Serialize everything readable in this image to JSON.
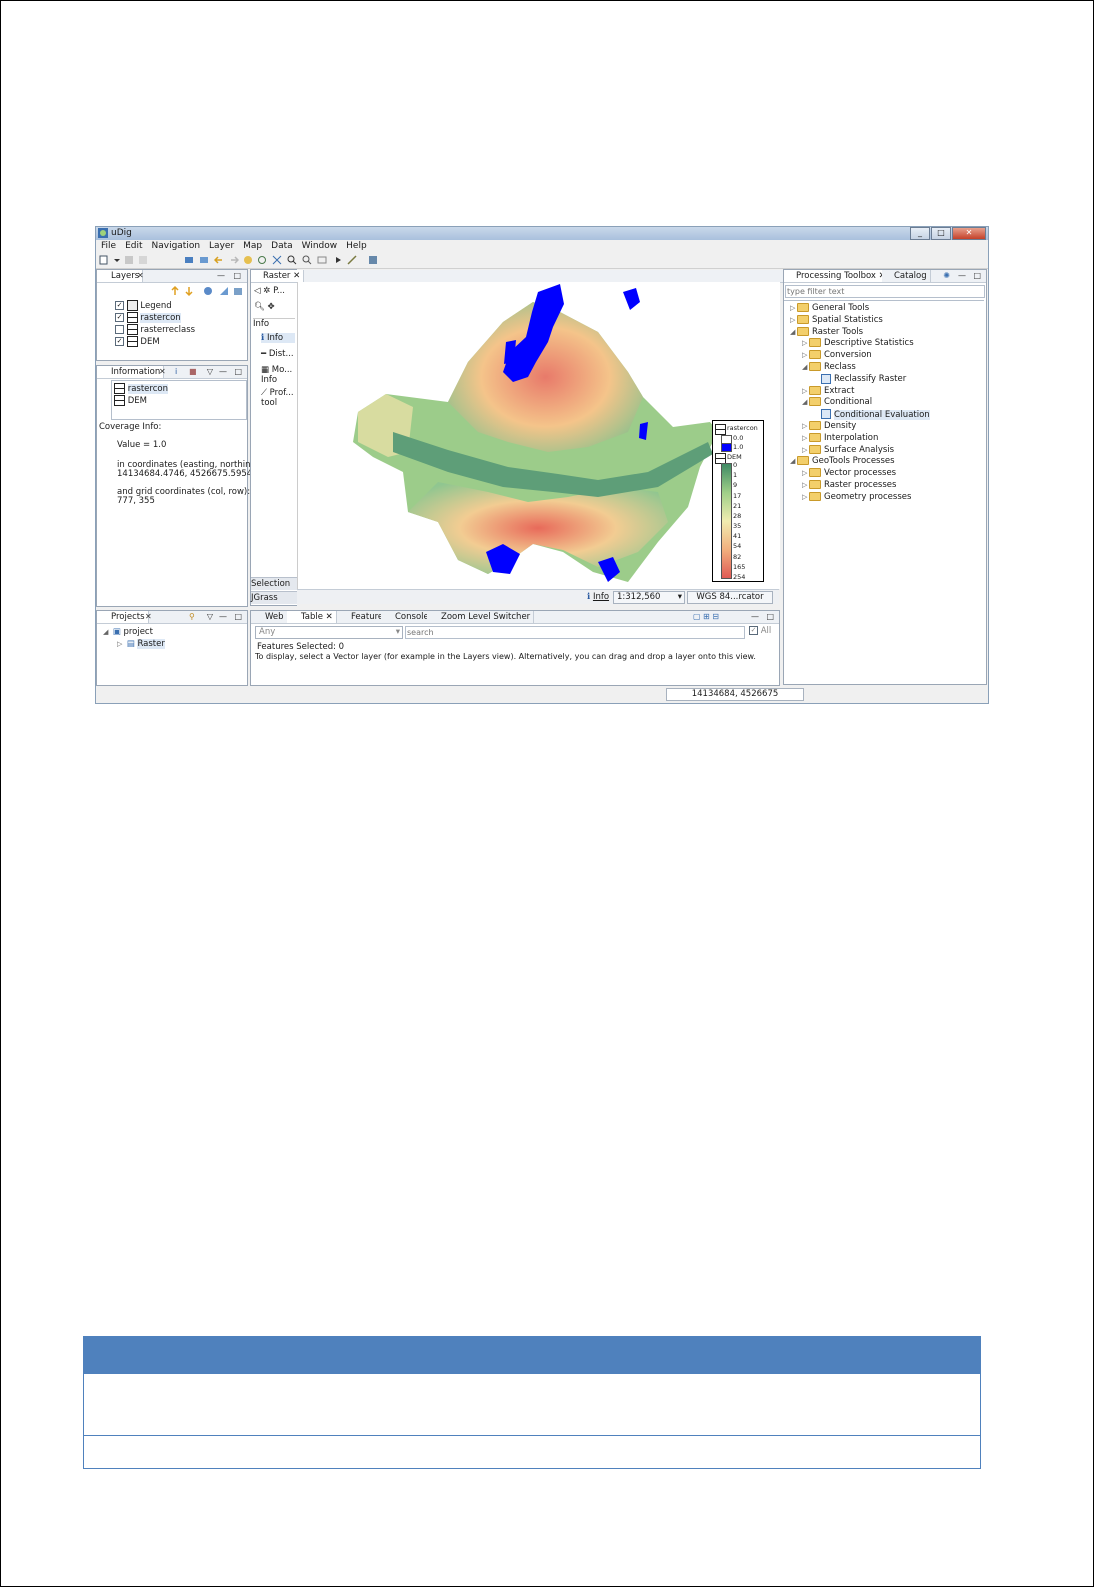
{
  "window": {
    "title": "uDig",
    "controls": [
      "_",
      "□",
      "✕"
    ]
  },
  "menu": [
    "File",
    "Edit",
    "Navigation",
    "Layer",
    "Map",
    "Data",
    "Window",
    "Help"
  ],
  "layers_panel": {
    "tab": "Layers",
    "items": [
      {
        "label": "Legend",
        "checked": true
      },
      {
        "label": "rastercon",
        "checked": true
      },
      {
        "label": "rasterreclass",
        "checked": false
      },
      {
        "label": "DEM",
        "checked": true
      }
    ]
  },
  "information_panel": {
    "tab": "Information",
    "layers": [
      "rastercon",
      "DEM"
    ],
    "coverage_label": "Coverage Info:",
    "value_line": "Value = 1.0",
    "coords_label": "in coordinates (easting, northing):",
    "coords_value": "14134684.4746, 4526675.5954",
    "grid_label": "and grid coordinates (col, row):",
    "grid_value": "777, 355"
  },
  "raster_side": {
    "tab": "Raster",
    "palette_label": "P...",
    "info_header": "Info",
    "tools": [
      "Info",
      "Dist...",
      "Mo... Info",
      "Prof... tool"
    ],
    "bottom_tabs": [
      "Selection",
      "JGrass"
    ]
  },
  "map_status": {
    "info_link": "Info",
    "scale": "1:312,560",
    "crs": "WGS 84...rcator"
  },
  "map_legend": {
    "layer1": "rastercon",
    "layer1_values": [
      "0.0",
      "1.0"
    ],
    "layer2": "DEM",
    "dem_values": [
      "0",
      "1",
      "9",
      "17",
      "21",
      "28",
      "35",
      "41",
      "54",
      "82",
      "165",
      "254"
    ]
  },
  "toolbox": {
    "tabs": [
      "Processing Toolbox",
      "Catalog"
    ],
    "filter_placeholder": "type filter text",
    "tree": [
      {
        "label": "General Tools",
        "depth": 0,
        "kind": "folder",
        "open": false
      },
      {
        "label": "Spatial Statistics",
        "depth": 0,
        "kind": "folder",
        "open": false
      },
      {
        "label": "Raster Tools",
        "depth": 0,
        "kind": "folder",
        "open": true
      },
      {
        "label": "Descriptive Statistics",
        "depth": 1,
        "kind": "folder",
        "open": false
      },
      {
        "label": "Conversion",
        "depth": 1,
        "kind": "folder",
        "open": false
      },
      {
        "label": "Reclass",
        "depth": 1,
        "kind": "folder",
        "open": true
      },
      {
        "label": "Reclassify Raster",
        "depth": 2,
        "kind": "tool"
      },
      {
        "label": "Extract",
        "depth": 1,
        "kind": "folder",
        "open": false
      },
      {
        "label": "Conditional",
        "depth": 1,
        "kind": "folder",
        "open": true
      },
      {
        "label": "Conditional Evaluation",
        "depth": 2,
        "kind": "tool",
        "selected": true
      },
      {
        "label": "Density",
        "depth": 1,
        "kind": "folder",
        "open": false
      },
      {
        "label": "Interpolation",
        "depth": 1,
        "kind": "folder",
        "open": false
      },
      {
        "label": "Surface Analysis",
        "depth": 1,
        "kind": "folder",
        "open": false
      },
      {
        "label": "GeoTools Processes",
        "depth": 0,
        "kind": "folder",
        "open": true
      },
      {
        "label": "Vector processes",
        "depth": 1,
        "kind": "folder",
        "open": false
      },
      {
        "label": "Raster processes",
        "depth": 1,
        "kind": "folder",
        "open": false
      },
      {
        "label": "Geometry processes",
        "depth": 1,
        "kind": "folder",
        "open": false
      }
    ]
  },
  "projects_panel": {
    "tab": "Projects",
    "project": "project",
    "map": "Raster"
  },
  "bottom_panel": {
    "tabs": [
      "Web",
      "Table",
      "Feature",
      "Console",
      "Zoom Level Switcher"
    ],
    "filter_select": "Any",
    "search_placeholder": "search",
    "all_label": "All",
    "features_selected": "Features Selected: 0",
    "hint": "To display, select a Vector layer (for example in the Layers view). Alternatively, you can drag and drop a layer onto this view."
  },
  "statusbar": {
    "coords": "14134684, 4526675"
  },
  "colors": {
    "accent_blue": "#4f81bd",
    "mask_blue": "#0000ff",
    "dem_low": "#4e9a6e",
    "dem_mid": "#f3f0a8",
    "dem_high": "#e0625a"
  }
}
